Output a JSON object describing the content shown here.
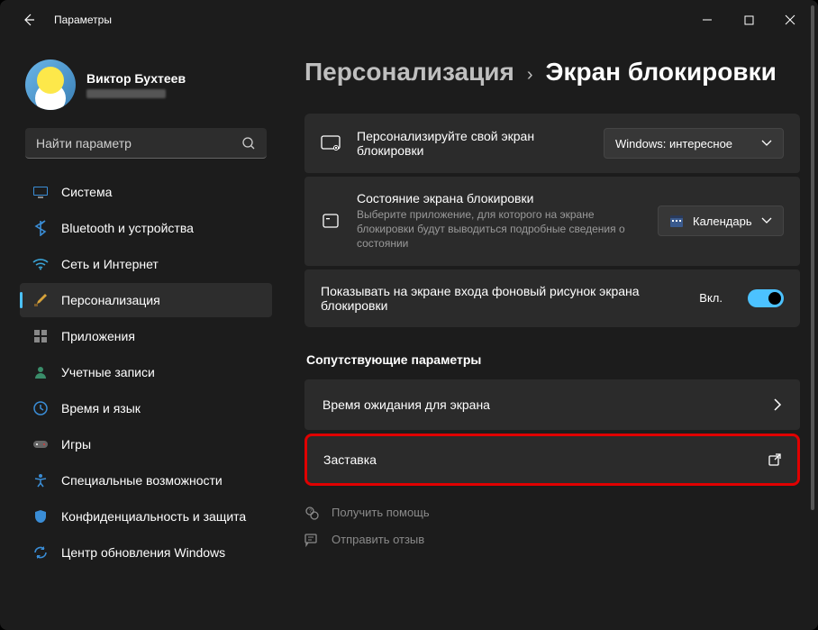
{
  "window": {
    "title": "Параметры"
  },
  "profile": {
    "name": "Виктор Бухтеев"
  },
  "search": {
    "placeholder": "Найти параметр"
  },
  "nav": {
    "items": [
      {
        "id": "system",
        "label": "Система"
      },
      {
        "id": "bluetooth",
        "label": "Bluetooth и устройства"
      },
      {
        "id": "network",
        "label": "Сеть и Интернет"
      },
      {
        "id": "personalization",
        "label": "Персонализация"
      },
      {
        "id": "apps",
        "label": "Приложения"
      },
      {
        "id": "accounts",
        "label": "Учетные записи"
      },
      {
        "id": "time",
        "label": "Время и язык"
      },
      {
        "id": "gaming",
        "label": "Игры"
      },
      {
        "id": "accessibility",
        "label": "Специальные возможности"
      },
      {
        "id": "privacy",
        "label": "Конфиденциальность и защита"
      },
      {
        "id": "update",
        "label": "Центр обновления Windows"
      }
    ],
    "active": "personalization"
  },
  "breadcrumb": {
    "parent": "Персонализация",
    "current": "Экран блокировки"
  },
  "settings": {
    "personalize": {
      "title": "Персонализируйте свой экран блокировки",
      "dropdown": "Windows: интересное"
    },
    "status": {
      "title": "Состояние экрана блокировки",
      "sub": "Выберите приложение, для которого на экране блокировки будут выводиться подробные сведения о состоянии",
      "dropdown": "Календарь"
    },
    "showbg": {
      "title": "Показывать на экране входа фоновый рисунок экрана блокировки",
      "state": "Вкл."
    }
  },
  "related": {
    "heading": "Сопутствующие параметры",
    "timeout": "Время ожидания для экрана",
    "screensaver": "Заставка"
  },
  "footer": {
    "help": "Получить помощь",
    "feedback": "Отправить отзыв"
  }
}
